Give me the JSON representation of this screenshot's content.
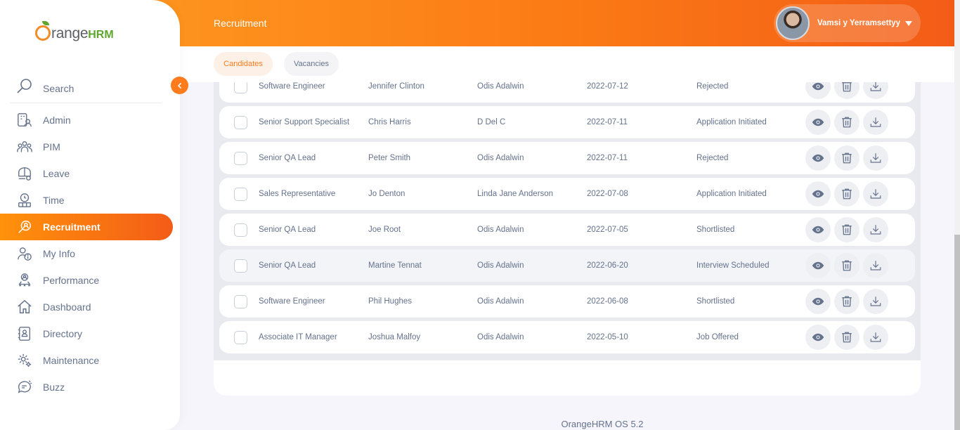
{
  "brand": {
    "logo_main": "range",
    "logo_suffix": "HRM",
    "logo_initial": "O"
  },
  "header": {
    "title": "Recruitment",
    "user_name": "Vamsi y Yerramsettyy"
  },
  "sidebar": {
    "search_label": "Search",
    "items": [
      {
        "label": "Admin",
        "icon": "admin-icon"
      },
      {
        "label": "PIM",
        "icon": "pim-icon"
      },
      {
        "label": "Leave",
        "icon": "leave-icon"
      },
      {
        "label": "Time",
        "icon": "time-icon"
      },
      {
        "label": "Recruitment",
        "icon": "recruitment-icon",
        "active": true
      },
      {
        "label": "My Info",
        "icon": "my-info-icon"
      },
      {
        "label": "Performance",
        "icon": "performance-icon"
      },
      {
        "label": "Dashboard",
        "icon": "dashboard-icon"
      },
      {
        "label": "Directory",
        "icon": "directory-icon"
      },
      {
        "label": "Maintenance",
        "icon": "maintenance-icon"
      },
      {
        "label": "Buzz",
        "icon": "buzz-icon"
      }
    ]
  },
  "tabs": [
    {
      "label": "Candidates",
      "active": true
    },
    {
      "label": "Vacancies"
    }
  ],
  "table": {
    "rows": [
      {
        "vacancy": "Software Engineer",
        "candidate": "Jennifer Clinton",
        "manager": "Odis Adalwin",
        "date": "2022-07-12",
        "status": "Rejected"
      },
      {
        "vacancy": "Senior Support Specialist",
        "candidate": "Chris Harris",
        "manager": "D Del C",
        "date": "2022-07-11",
        "status": "Application Initiated"
      },
      {
        "vacancy": "Senior QA Lead",
        "candidate": "Peter Smith",
        "manager": "Odis Adalwin",
        "date": "2022-07-11",
        "status": "Rejected"
      },
      {
        "vacancy": "Sales Representative",
        "candidate": "Jo Denton",
        "manager": "Linda Jane Anderson",
        "date": "2022-07-08",
        "status": "Application Initiated"
      },
      {
        "vacancy": "Senior QA Lead",
        "candidate": "Joe Root",
        "manager": "Odis Adalwin",
        "date": "2022-07-05",
        "status": "Shortlisted"
      },
      {
        "vacancy": "Senior QA Lead",
        "candidate": "Martine Tennat",
        "manager": "Odis Adalwin",
        "date": "2022-06-20",
        "status": "Interview Scheduled",
        "hover": true
      },
      {
        "vacancy": "Software Engineer",
        "candidate": "Phil Hughes",
        "manager": "Odis Adalwin",
        "date": "2022-06-08",
        "status": "Shortlisted"
      },
      {
        "vacancy": "Associate IT Manager",
        "candidate": "Joshua Malfoy",
        "manager": "Odis Adalwin",
        "date": "2022-05-10",
        "status": "Job Offered"
      }
    ],
    "row_actions": [
      "view-icon",
      "delete-icon",
      "download-icon"
    ]
  },
  "footer": {
    "version": "OrangeHRM OS 5.2"
  },
  "colors": {
    "accent": "#ff7b1d",
    "brand_green": "#5fa62e",
    "text": "#64728c"
  }
}
